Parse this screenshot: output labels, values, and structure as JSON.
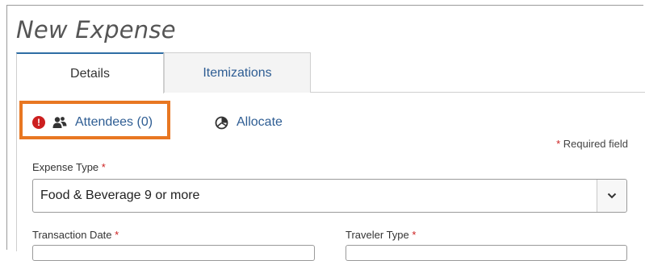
{
  "page": {
    "title": "New Expense"
  },
  "tabs": [
    {
      "label": "Details",
      "active": true
    },
    {
      "label": "Itemizations",
      "active": false
    }
  ],
  "actions": {
    "attendees_label": "Attendees (0)",
    "allocate_label": "Allocate",
    "alert_icon": "alert-exclamation-icon",
    "attendees_icon": "people-icon",
    "allocate_icon": "pie-chart-icon"
  },
  "form": {
    "required_note": "Required field",
    "required_marker": "*",
    "expense_type": {
      "label": "Expense Type",
      "value": "Food & Beverage 9 or more"
    },
    "transaction_date": {
      "label": "Transaction Date"
    },
    "traveler_type": {
      "label": "Traveler Type"
    }
  },
  "colors": {
    "link": "#2e5d93",
    "active_tab_border": "#2e6da4",
    "highlight": "#e87722",
    "alert": "#cc1f1f"
  }
}
